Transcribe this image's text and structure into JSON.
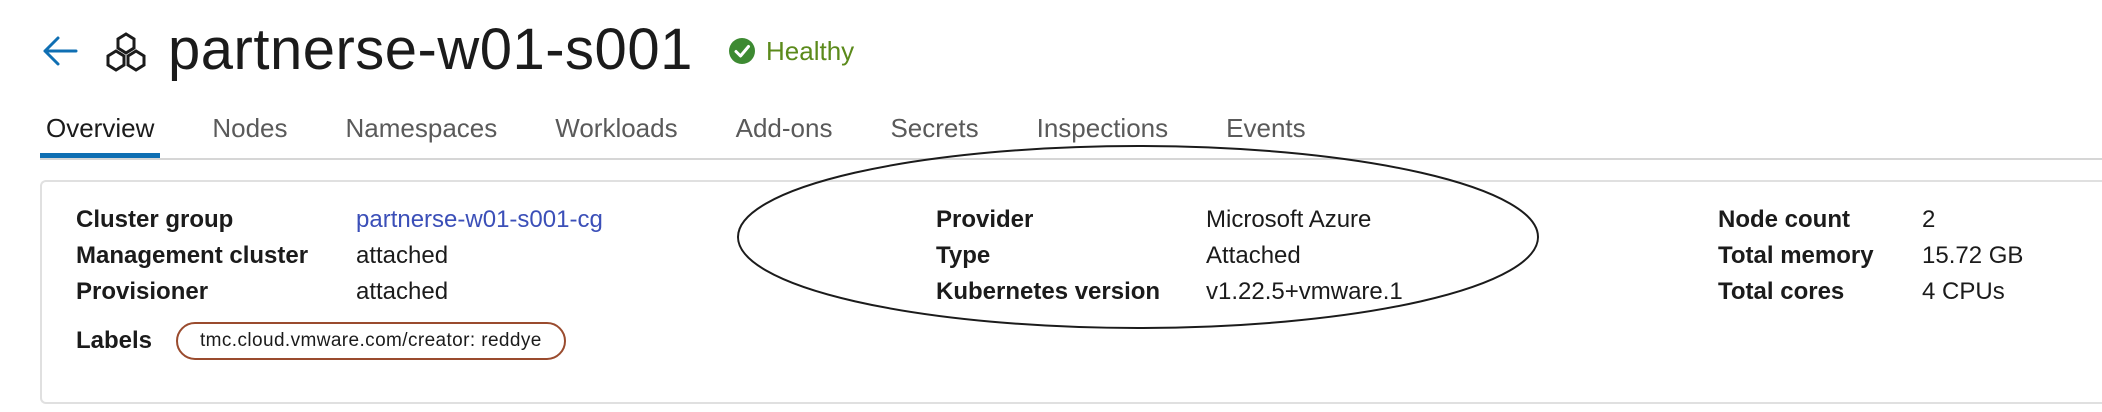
{
  "header": {
    "title": "partnerse-w01-s001",
    "status": "Healthy",
    "status_color": "#5b8a1b",
    "back_icon": "back-arrow-icon",
    "cluster_icon": "cluster-icon"
  },
  "tabs": [
    {
      "label": "Overview",
      "active": true
    },
    {
      "label": "Nodes"
    },
    {
      "label": "Namespaces"
    },
    {
      "label": "Workloads"
    },
    {
      "label": "Add-ons"
    },
    {
      "label": "Secrets"
    },
    {
      "label": "Inspections"
    },
    {
      "label": "Events"
    }
  ],
  "overview": {
    "cluster_group": {
      "label": "Cluster group",
      "value": "partnerse-w01-s001-cg"
    },
    "management_cluster": {
      "label": "Management cluster",
      "value": "attached"
    },
    "provisioner": {
      "label": "Provisioner",
      "value": "attached"
    },
    "labels": {
      "label": "Labels",
      "chip": "tmc.cloud.vmware.com/creator: reddye"
    },
    "provider": {
      "label": "Provider",
      "value": "Microsoft Azure"
    },
    "type": {
      "label": "Type",
      "value": "Attached"
    },
    "kubernetes_version": {
      "label": "Kubernetes version",
      "value": "v1.22.5+vmware.1"
    },
    "node_count": {
      "label": "Node count",
      "value": "2"
    },
    "total_memory": {
      "label": "Total memory",
      "value": "15.72 GB"
    },
    "total_cores": {
      "label": "Total cores",
      "value": "4 CPUs"
    }
  },
  "colors": {
    "accent": "#0f6fb3",
    "link": "#3b4fb8",
    "chip_border": "#9a4b2e"
  }
}
